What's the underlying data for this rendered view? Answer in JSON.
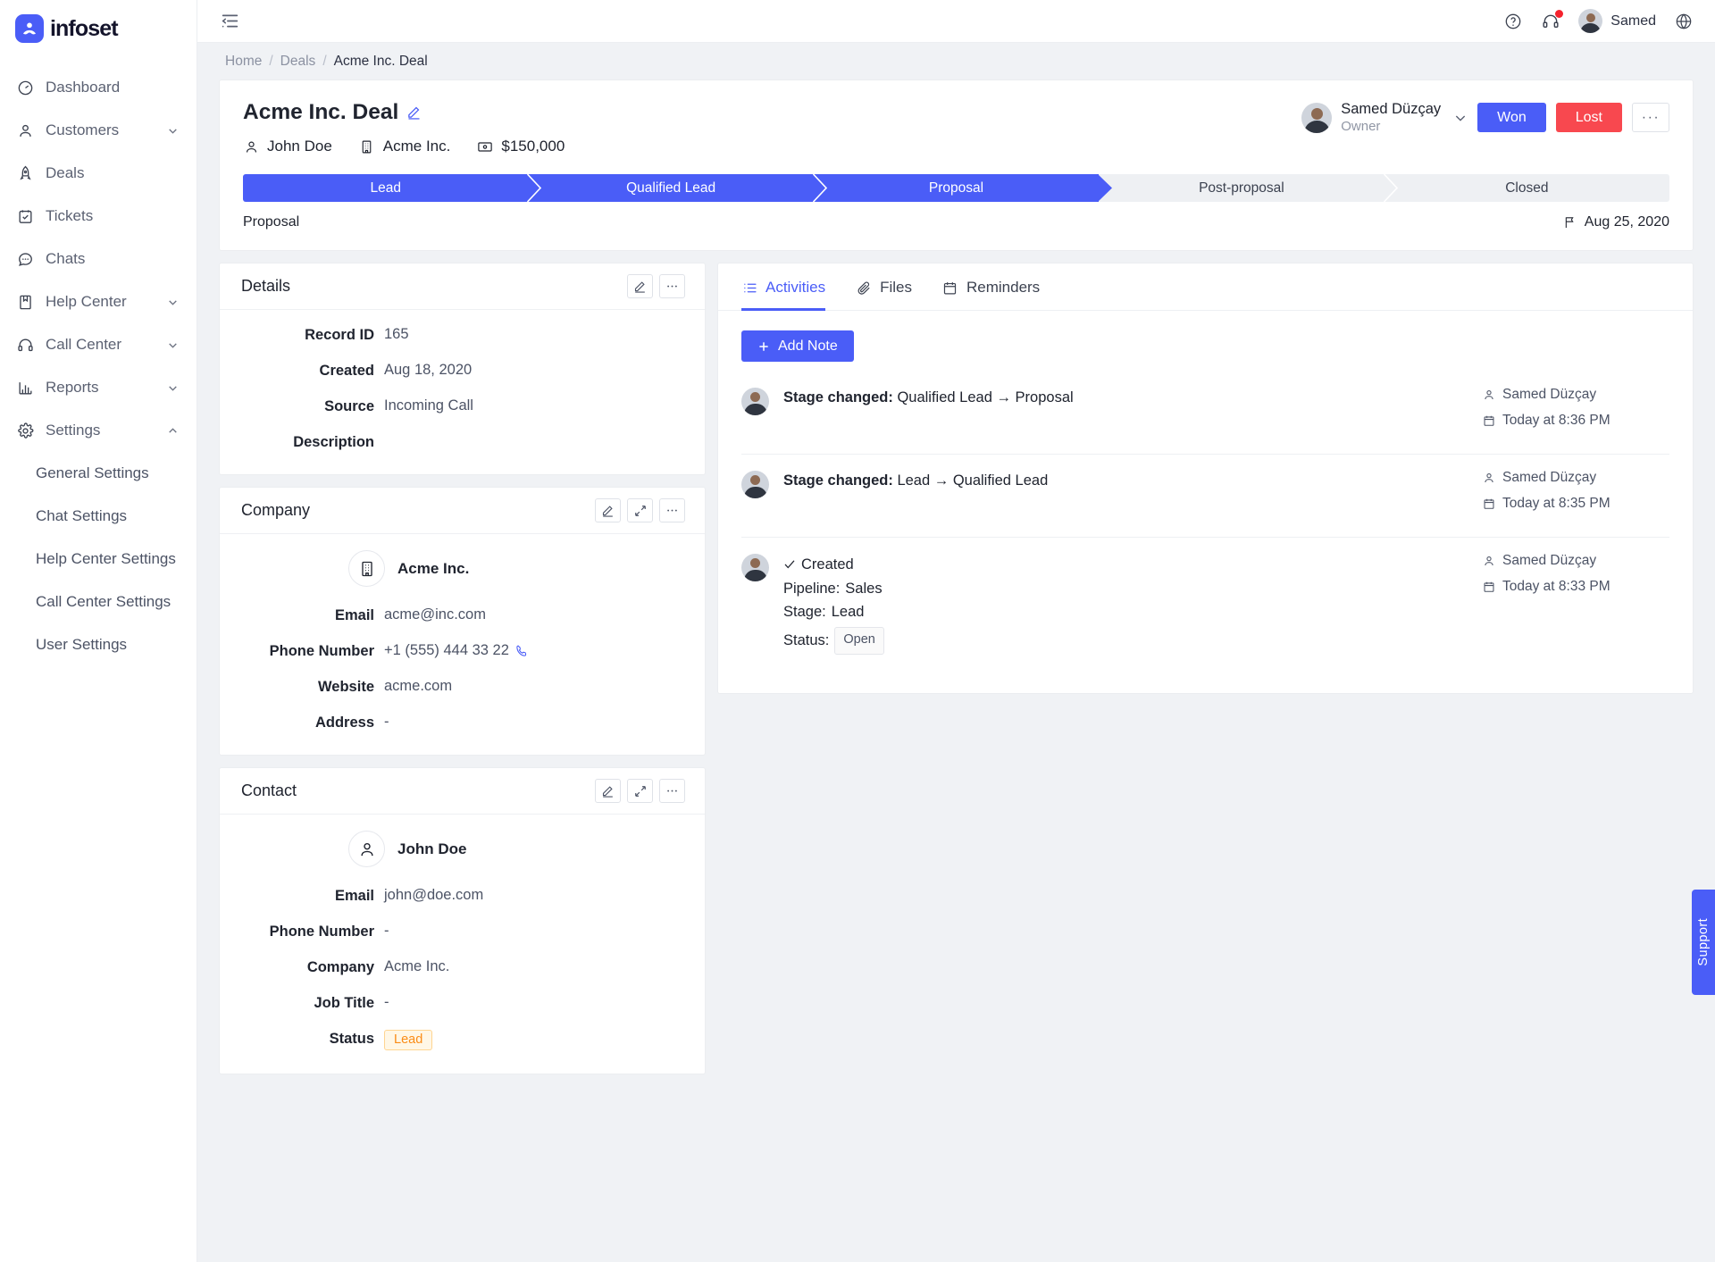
{
  "brand": {
    "name": "infoset",
    "accent": "#4a5df7"
  },
  "sidebar": {
    "items": [
      {
        "label": "Dashboard",
        "icon": "dashboard-icon",
        "expandable": false
      },
      {
        "label": "Customers",
        "icon": "user-icon",
        "expandable": true,
        "expanded": false
      },
      {
        "label": "Deals",
        "icon": "rocket-icon",
        "expandable": false
      },
      {
        "label": "Tickets",
        "icon": "ticket-icon",
        "expandable": false
      },
      {
        "label": "Chats",
        "icon": "chat-icon",
        "expandable": false
      },
      {
        "label": "Help Center",
        "icon": "book-icon",
        "expandable": true,
        "expanded": false
      },
      {
        "label": "Call Center",
        "icon": "headset-icon",
        "expandable": true,
        "expanded": false
      },
      {
        "label": "Reports",
        "icon": "chart-icon",
        "expandable": true,
        "expanded": false
      },
      {
        "label": "Settings",
        "icon": "gear-icon",
        "expandable": true,
        "expanded": true
      }
    ],
    "settings_children": [
      {
        "label": "General Settings"
      },
      {
        "label": "Chat Settings"
      },
      {
        "label": "Help Center Settings"
      },
      {
        "label": "Call Center Settings"
      },
      {
        "label": "User Settings"
      }
    ]
  },
  "topbar": {
    "collapse_icon": "sidebar-collapse-icon",
    "help_icon": "help-circle-icon",
    "headset_icon": "headset-icon",
    "headset_has_badge": true,
    "user_name": "Samed",
    "globe_icon": "globe-icon"
  },
  "breadcrumb": {
    "home": "Home",
    "section": "Deals",
    "current": "Acme Inc. Deal",
    "separator": "/"
  },
  "deal": {
    "title": "Acme Inc. Deal",
    "edit_icon": "pencil-icon",
    "meta": [
      {
        "icon": "person-icon",
        "label": "John Doe"
      },
      {
        "icon": "building-icon",
        "label": "Acme Inc."
      },
      {
        "icon": "money-icon",
        "label": "$150,000"
      }
    ],
    "owner": {
      "name": "Samed Düzçay",
      "role": "Owner",
      "chevron": "chevron-down-icon"
    },
    "won_label": "Won",
    "lost_label": "Lost",
    "more_label": "···",
    "won_color": "#4a5df7",
    "lost_color": "#f8484f",
    "stages": [
      {
        "label": "Lead",
        "state": "done"
      },
      {
        "label": "Qualified Lead",
        "state": "done"
      },
      {
        "label": "Proposal",
        "state": "done"
      },
      {
        "label": "Post-proposal",
        "state": "todo"
      },
      {
        "label": "Closed",
        "state": "todo"
      }
    ],
    "current_stage": "Proposal",
    "stage_date": "Aug 25, 2020",
    "stage_date_icon": "flag-icon"
  },
  "details_panel": {
    "title": "Details",
    "tools": [
      "pencil-icon",
      "more-icon"
    ],
    "fields": [
      {
        "label": "Record ID",
        "value": "165"
      },
      {
        "label": "Created",
        "value": "Aug 18, 2020"
      },
      {
        "label": "Source",
        "value": "Incoming Call"
      },
      {
        "label": "Description",
        "value": ""
      }
    ]
  },
  "company_panel": {
    "title": "Company",
    "tools": [
      "pencil-icon",
      "expand-icon",
      "more-icon"
    ],
    "entity_name": "Acme Inc.",
    "entity_icon": "building-icon",
    "fields": [
      {
        "label": "Email",
        "value": "acme@inc.com"
      },
      {
        "label": "Phone Number",
        "value": "+1 (555) 444 33 22",
        "trailing_icon": "phone-call-icon"
      },
      {
        "label": "Website",
        "value": "acme.com"
      },
      {
        "label": "Address",
        "value": "-"
      }
    ]
  },
  "contact_panel": {
    "title": "Contact",
    "tools": [
      "pencil-icon",
      "expand-icon",
      "more-icon"
    ],
    "entity_name": "John Doe",
    "entity_icon": "person-icon",
    "fields": [
      {
        "label": "Email",
        "value": "john@doe.com"
      },
      {
        "label": "Phone Number",
        "value": "-"
      },
      {
        "label": "Company",
        "value": "Acme Inc."
      },
      {
        "label": "Job Title",
        "value": "-"
      }
    ],
    "status_label": "Status",
    "status_value": "Lead"
  },
  "activities_panel": {
    "tabs": [
      {
        "label": "Activities",
        "icon": "list-icon",
        "active": true
      },
      {
        "label": "Files",
        "icon": "paperclip-icon",
        "active": false
      },
      {
        "label": "Reminders",
        "icon": "calendar-icon",
        "active": false
      }
    ],
    "add_note_label": "Add Note",
    "add_note_icon": "plus-icon",
    "items": [
      {
        "kind": "stage-change",
        "prefix": "Stage changed:",
        "body": "Qualified Lead → Proposal",
        "user": "Samed Düzçay",
        "time": "Today at 8:36 PM",
        "user_icon": "person-icon",
        "time_icon": "calendar-icon"
      },
      {
        "kind": "stage-change",
        "prefix": "Stage changed:",
        "body": "Lead → Qualified Lead",
        "user": "Samed Düzçay",
        "time": "Today at 8:35 PM",
        "user_icon": "person-icon",
        "time_icon": "calendar-icon"
      },
      {
        "kind": "created",
        "title": "Created",
        "check_icon": "check-icon",
        "pipeline_label": "Pipeline:",
        "pipeline_value": "Sales",
        "stage_label": "Stage:",
        "stage_value": "Lead",
        "status_label": "Status:",
        "status_value": "Open",
        "user": "Samed Düzçay",
        "time": "Today at 8:33 PM",
        "user_icon": "person-icon",
        "time_icon": "calendar-icon"
      }
    ]
  },
  "support_tab": {
    "label": "Support"
  }
}
